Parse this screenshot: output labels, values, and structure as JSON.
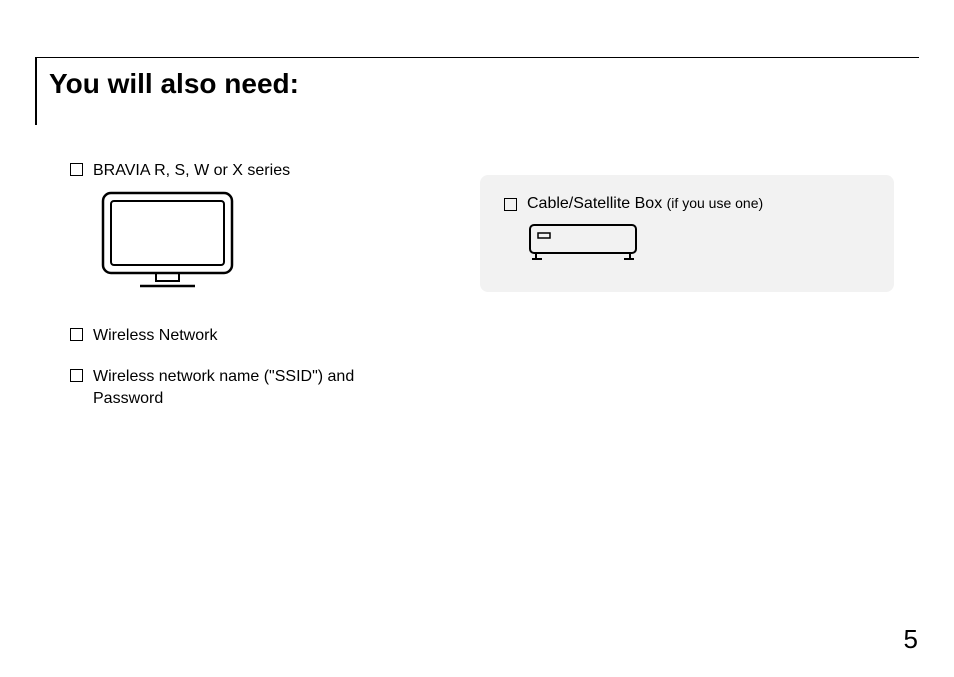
{
  "title": "You will also need:",
  "leftItems": {
    "tv": "BRAVIA R, S, W or X series",
    "wireless": "Wireless Network",
    "ssid": "Wireless network name (\"SSID\") and Password"
  },
  "rightItem": {
    "label": "Cable/Satellite Box ",
    "suffix": "(if you use one)"
  },
  "pageNumber": "5"
}
